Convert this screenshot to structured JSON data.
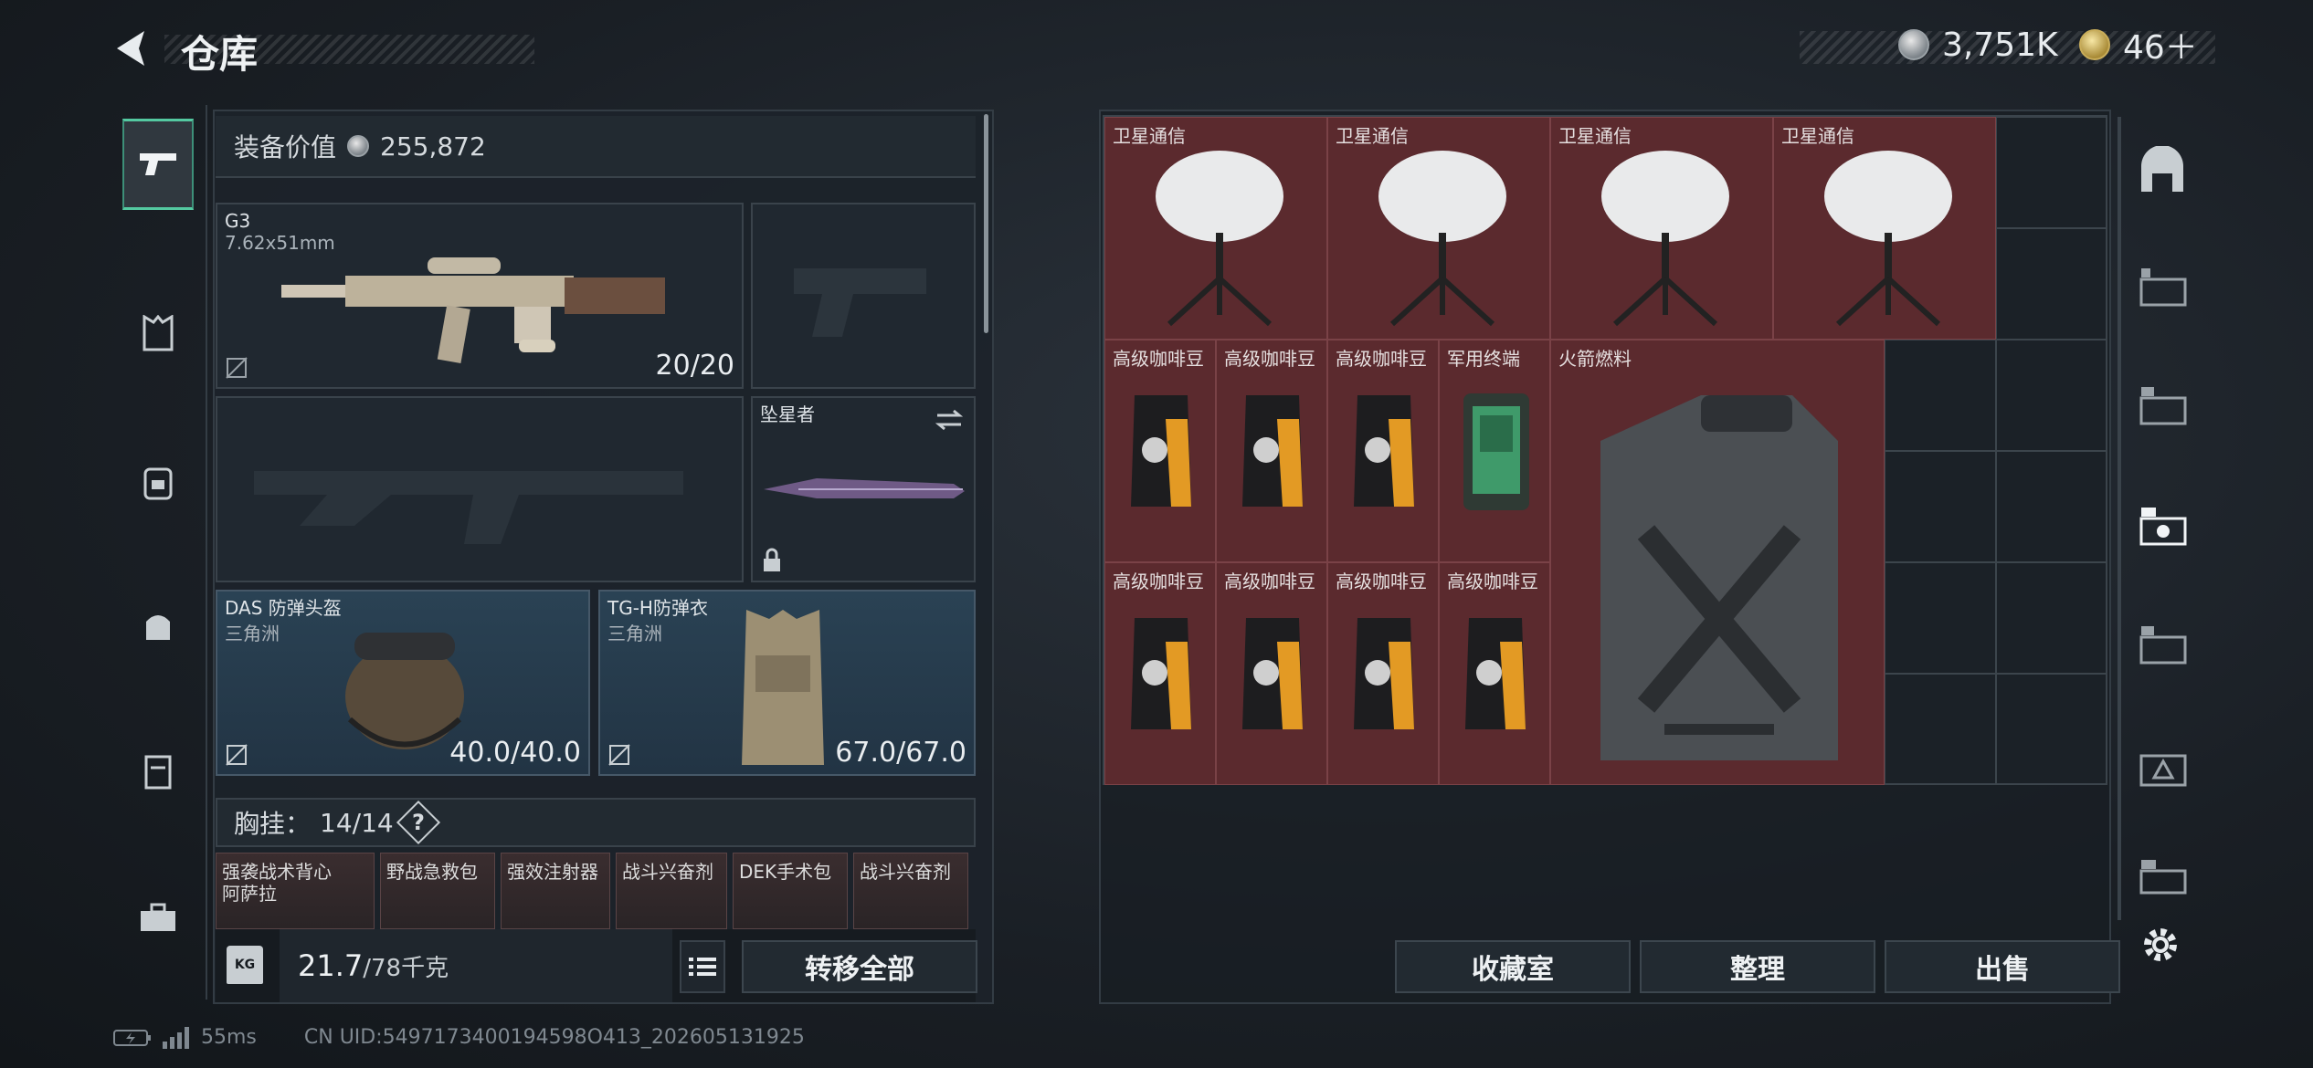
{
  "header": {
    "title": "仓库",
    "currency": [
      {
        "icon": "silver-coin-icon",
        "value": "3,751K"
      },
      {
        "icon": "gold-coin-icon",
        "value": "46＋"
      }
    ]
  },
  "equipment": {
    "value_label": "装备价值",
    "value": "255,872",
    "primary": {
      "name": "G3",
      "ammo": "7.62x51mm",
      "durability": "20/20"
    },
    "melee": {
      "name": "坠星者"
    },
    "helmet": {
      "name": "DAS 防弹头盔",
      "map": "三角洲",
      "durability": "40.0/40.0"
    },
    "armor": {
      "name": "TG-H防弹衣",
      "map": "三角洲",
      "durability": "67.0/67.0"
    },
    "chest": {
      "label": "胸挂：",
      "capacity": "14/14",
      "help": "?",
      "items": [
        "强袭战术背心",
        "野战急救包",
        "强效注射器",
        "战斗兴奋剂",
        "DEK手术包",
        "战斗兴奋剂"
      ],
      "sub": "阿萨拉"
    },
    "weight": {
      "unit_icon": "KG",
      "value": "21.7",
      "max": "/78千克"
    },
    "transfer_all": "转移全部"
  },
  "storage": {
    "items": [
      {
        "name": "卫星通信"
      },
      {
        "name": "卫星通信"
      },
      {
        "name": "卫星通信"
      },
      {
        "name": "卫星通信"
      },
      {
        "name": "高级咖啡豆"
      },
      {
        "name": "高级咖啡豆"
      },
      {
        "name": "高级咖啡豆"
      },
      {
        "name": "军用终端"
      },
      {
        "name": "火箭燃料"
      },
      {
        "name": "高级咖啡豆"
      },
      {
        "name": "高级咖啡豆"
      },
      {
        "name": "高级咖啡豆"
      },
      {
        "name": "高级咖啡豆"
      }
    ],
    "buttons": {
      "collection": "收藏室",
      "sort": "整理",
      "sell": "出售"
    }
  },
  "status": {
    "ping": "55ms",
    "uid": "CN UID:5497173400194598O413_202605131925"
  },
  "colors": {
    "item_bg": "#5b2a2e",
    "accent": "#54c9a1"
  }
}
